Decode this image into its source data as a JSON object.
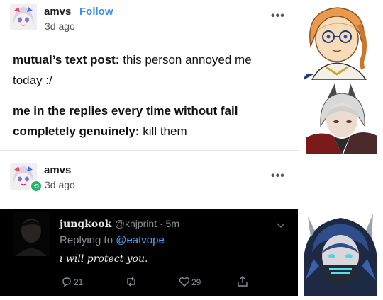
{
  "post1": {
    "username": "amvs",
    "follow_label": "Follow",
    "time": "3d ago",
    "menu_icon": "more-dots-icon",
    "line1_bold": "mutual’s text post:",
    "line1_rest": " this person annoyed me",
    "line2": "today :/",
    "line3": "me in the replies every time without fail",
    "line4_bold": "completely genuinely:",
    "line4_rest": " kill them"
  },
  "post2": {
    "username": "amvs",
    "time": "3d ago",
    "menu_icon": "more-dots-icon",
    "reblog_icon": "reblog-icon"
  },
  "tweet": {
    "name": "jungkook",
    "handle": "@knjprint · 5m",
    "replying_prefix": "Replying to ",
    "replying_to": "@eatvope",
    "text": "i will protect you.",
    "replies": "21",
    "likes": "29",
    "icons": [
      "reply-icon",
      "retweet-icon",
      "like-icon",
      "share-icon",
      "chevron-down-icon"
    ]
  },
  "colors": {
    "follow": "#3a8ff0",
    "link": "#4aa3f0",
    "tweet_bg": "#000000",
    "reblog_badge": "#27b36b"
  }
}
